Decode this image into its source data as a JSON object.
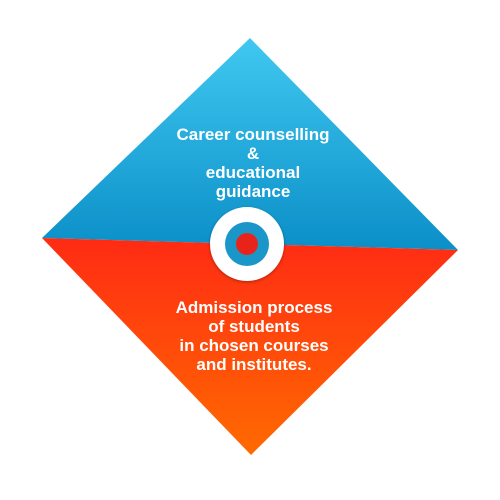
{
  "diagram": {
    "top_block": {
      "lines": [
        "Career counselling",
        "&",
        "educational",
        "guidance"
      ]
    },
    "bottom_block": {
      "lines": [
        "Admission process",
        "of students",
        "in chosen courses",
        "and institutes."
      ]
    },
    "colors": {
      "top_gradient_start": "#40c8f0",
      "top_gradient_end": "#0b8fc8",
      "bottom_gradient_start": "#ff2b14",
      "bottom_gradient_end": "#ff6a00",
      "center_outer": "#ffffff",
      "center_ring": "#1a96c8",
      "center_dot": "#e8241a"
    }
  }
}
